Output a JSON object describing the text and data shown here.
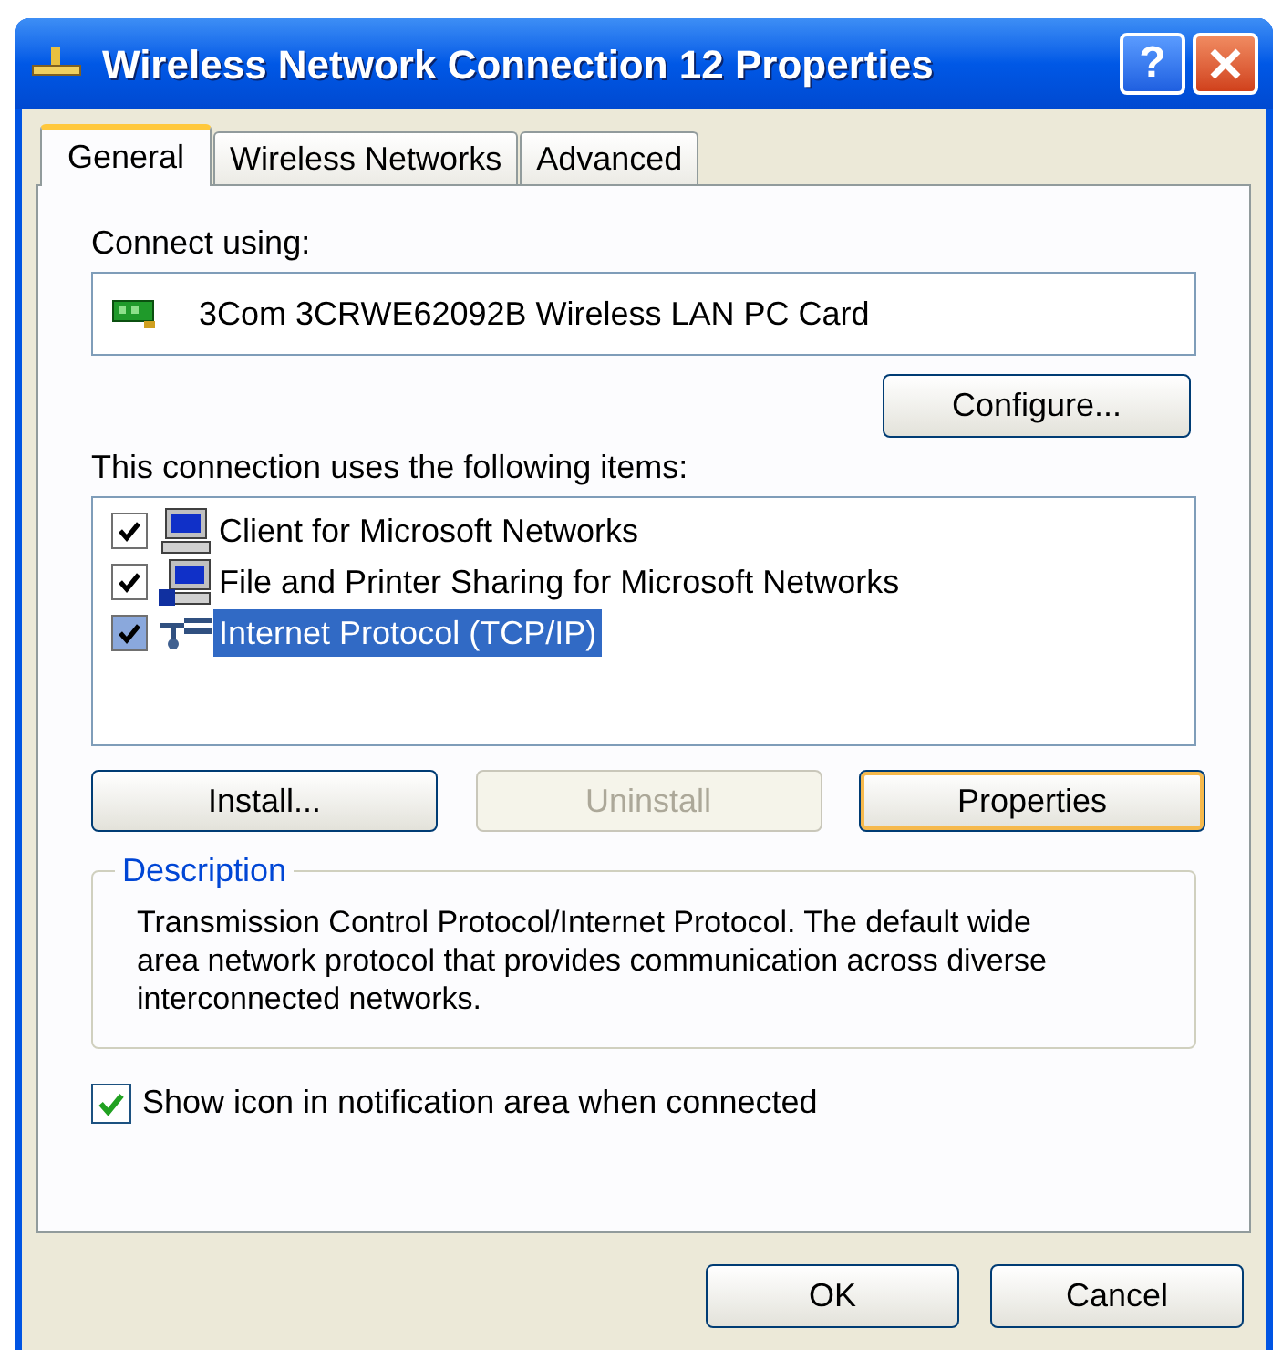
{
  "window": {
    "title": "Wireless Network Connection 12 Properties",
    "help": "?"
  },
  "tabs": [
    {
      "label": "General",
      "selected": true
    },
    {
      "label": "Wireless Networks",
      "selected": false
    },
    {
      "label": "Advanced",
      "selected": false
    }
  ],
  "connect_using": {
    "label": "Connect using:",
    "adapter": "3Com 3CRWE62092B Wireless LAN PC Card"
  },
  "configure_button": "Configure...",
  "items_label": "This connection uses the following items:",
  "items": [
    {
      "kind": "client",
      "label": "Client for Microsoft Networks",
      "checked": true,
      "selected": false
    },
    {
      "kind": "sharing",
      "label": "File and Printer Sharing for Microsoft Networks",
      "checked": true,
      "selected": false
    },
    {
      "kind": "protocol",
      "label": "Internet Protocol (TCP/IP)",
      "checked": true,
      "selected": true
    }
  ],
  "item_buttons": [
    {
      "label": "Install...",
      "disabled": false,
      "default": false
    },
    {
      "label": "Uninstall",
      "disabled": true,
      "default": false
    },
    {
      "label": "Properties",
      "disabled": false,
      "default": true
    }
  ],
  "description": {
    "title": "Description",
    "text": "Transmission Control Protocol/Internet Protocol. The default wide area network protocol that provides communication across diverse interconnected networks."
  },
  "show_icon": {
    "label": "Show icon in notification area when connected",
    "checked": true
  },
  "dialog_buttons": [
    {
      "label": "OK"
    },
    {
      "label": "Cancel"
    }
  ]
}
